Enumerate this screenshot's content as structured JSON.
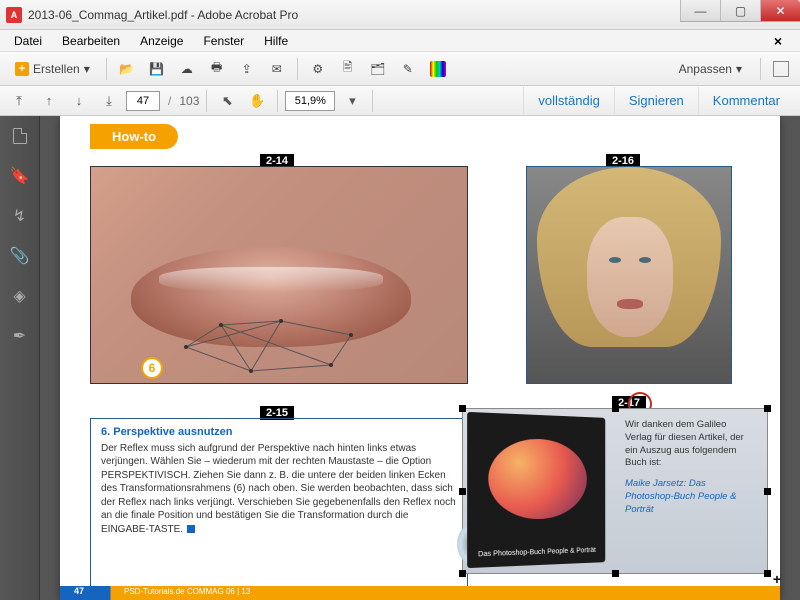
{
  "window": {
    "title": "2013-06_Commag_Artikel.pdf - Adobe Acrobat Pro"
  },
  "menu": {
    "file": "Datei",
    "edit": "Bearbeiten",
    "view": "Anzeige",
    "window": "Fenster",
    "help": "Hilfe",
    "close": "×"
  },
  "toolbar": {
    "create": "Erstellen",
    "customize": "Anpassen"
  },
  "nav": {
    "page": "47",
    "sep": "/",
    "total": "103",
    "zoom": "51,9%"
  },
  "actions": {
    "full": "vollständig",
    "sign": "Signieren",
    "comment": "Kommentar"
  },
  "page": {
    "howto": "How-to",
    "labels": {
      "a": "2-14",
      "b": "2-15",
      "c": "2-16",
      "d": "2-17"
    },
    "circle": "6",
    "box215": {
      "title": "6. Perspektive ausnutzen",
      "body": "Der Reflex muss sich aufgrund der Perspektive nach hinten links etwas verjüngen. Wählen Sie – wiederum mit der rechten Maustaste – die Option PERSPEKTIVISCH. Ziehen Sie dann z. B. die untere der beiden linken Ecken des Transformationsrahmens (6) nach oben. Sie werden beobachten, dass sich der Reflex nach links verjüngt. Verschieben Sie gegebenenfalls den Reflex noch an die finale Position und bestätigen Sie die Transformation durch die EINGABE-TASTE."
    },
    "box217": {
      "text": "Wir danken dem Galileo Verlag für diesen Artikel, der ein Auszug aus folgendem Buch ist:",
      "booktitle": "Das Photoshop-Buch People & Porträt",
      "credit": "Maike Jarsetz: Das Photoshop-Buch People & Porträt"
    },
    "footer": {
      "page": "47",
      "text": "PSD-Tutorials.de  COMMAG 06 | 13"
    }
  }
}
